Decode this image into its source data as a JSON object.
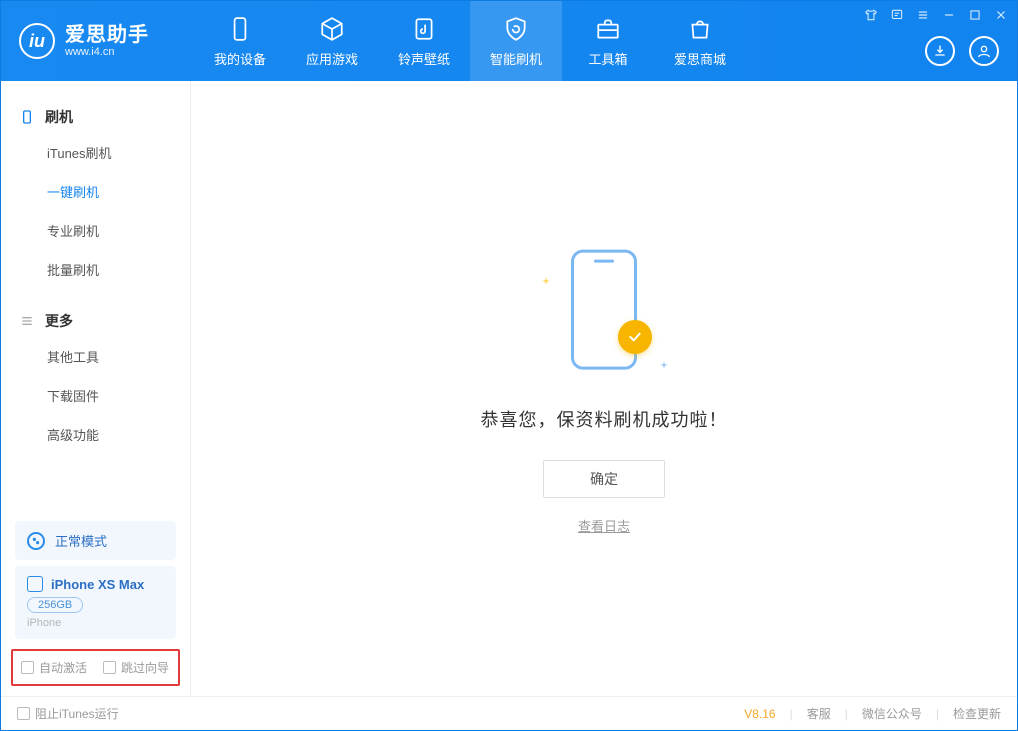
{
  "app": {
    "name_cn": "爱思助手",
    "name_en": "www.i4.cn",
    "logo_letter": "iu"
  },
  "tabs": {
    "device": "我的设备",
    "apps": "应用游戏",
    "ringtone": "铃声壁纸",
    "flash": "智能刷机",
    "toolbox": "工具箱",
    "store": "爱思商城"
  },
  "sidebar": {
    "section1": {
      "title": "刷机",
      "items": {
        "itunes": "iTunes刷机",
        "oneclick": "一键刷机",
        "pro": "专业刷机",
        "batch": "批量刷机"
      }
    },
    "section2": {
      "title": "更多",
      "items": {
        "other": "其他工具",
        "firmware": "下载固件",
        "advanced": "高级功能"
      }
    },
    "mode_label": "正常模式",
    "device": {
      "name": "iPhone XS Max",
      "capacity": "256GB",
      "type": "iPhone"
    },
    "checkboxes": {
      "auto_activate": "自动激活",
      "skip_wizard": "跳过向导"
    }
  },
  "main": {
    "message": "恭喜您，保资料刷机成功啦！",
    "ok_button": "确定",
    "view_log": "查看日志"
  },
  "statusbar": {
    "block_itunes": "阻止iTunes运行",
    "version": "V8.16",
    "support": "客服",
    "wechat": "微信公众号",
    "check_update": "检查更新"
  }
}
